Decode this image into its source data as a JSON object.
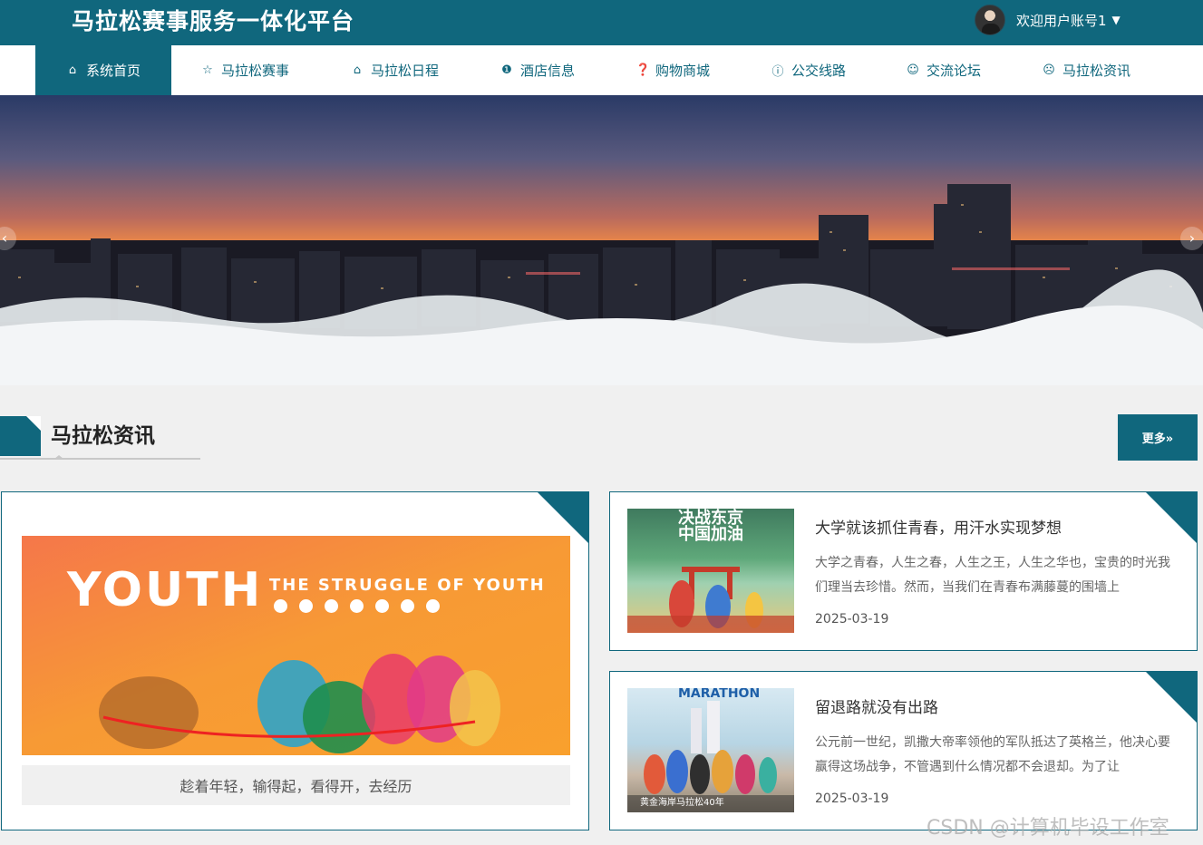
{
  "header": {
    "title": "马拉松赛事服务一体化平台",
    "welcome": "欢迎用户账号1",
    "caret": "▼"
  },
  "nav": {
    "items": [
      {
        "label": "系统首页",
        "icon": "⌂",
        "icon_name": "home-icon",
        "active": true
      },
      {
        "label": "马拉松赛事",
        "icon": "☆",
        "icon_name": "star-icon"
      },
      {
        "label": "马拉松日程",
        "icon": "⌂",
        "icon_name": "bag-icon"
      },
      {
        "label": "酒店信息",
        "icon": "❶",
        "icon_name": "alert-icon"
      },
      {
        "label": "购物商城",
        "icon": "❓",
        "icon_name": "help-icon"
      },
      {
        "label": "公交线路",
        "icon": "ⓘ",
        "icon_name": "info-icon"
      },
      {
        "label": "交流论坛",
        "icon": "☺",
        "icon_name": "smile-icon"
      },
      {
        "label": "马拉松资讯",
        "icon": "☹",
        "icon_name": "face-icon"
      }
    ]
  },
  "banner": {
    "prev": "‹",
    "next": "›"
  },
  "news_section": {
    "title": "马拉松资讯",
    "more_label": "更多»"
  },
  "feature": {
    "image_text": "YOUTH",
    "image_sub": "THE STRUGGLE OF YOUTH",
    "caption": "趁着年轻，输得起，看得开，去经历"
  },
  "news": [
    {
      "title": "大学就该抓住青春，用汗水实现梦想",
      "summary": "大学之青春，人生之春，人生之王，人生之华也，宝贵的时光我们理当去珍惜。然而，当我们在青春布满藤蔓的围墙上",
      "date": "2025-03-19",
      "thumb_title": "决战东京",
      "thumb_sub": "中国加油"
    },
    {
      "title": "留退路就没有出路",
      "summary": "公元前一世纪，凯撒大帝率领他的军队抵达了英格兰，他决心要赢得这场战争，不管遇到什么情况都不会退却。为了让",
      "date": "2025-03-19",
      "thumb_title": "MARATHON",
      "thumb_sub": "黄金海岸马拉松40年"
    }
  ],
  "watermark": "CSDN @计算机毕设工作室",
  "colors": {
    "primary": "#10677d",
    "background": "#f0f0f0"
  }
}
